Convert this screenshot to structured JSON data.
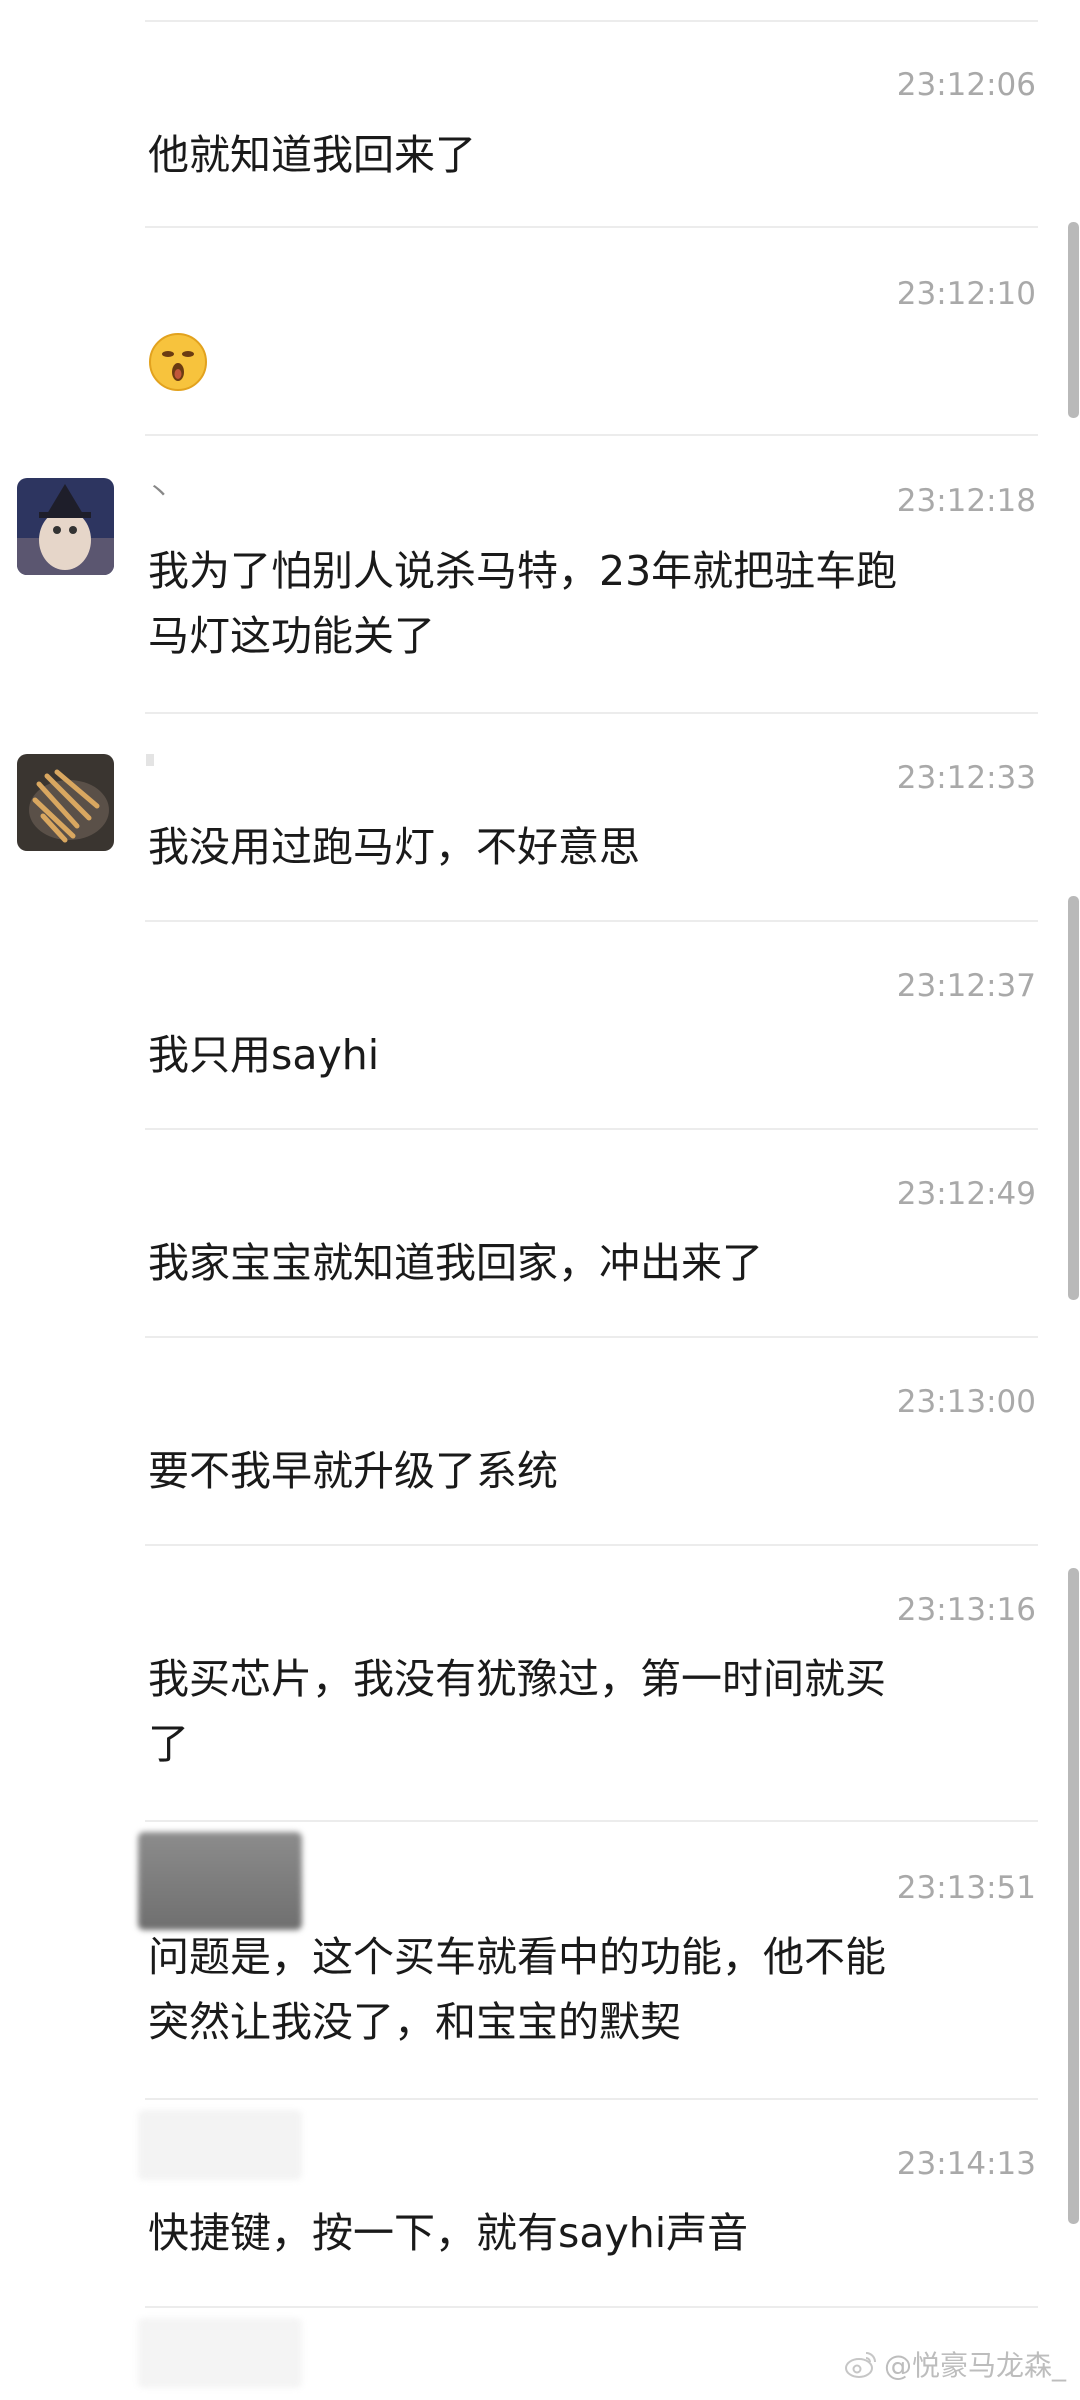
{
  "messages": [
    {
      "time": "23:12:06",
      "text": "他就知道我回来了"
    },
    {
      "time": "23:12:10",
      "emoji": "surprised-face-emoji"
    },
    {
      "time": "23:12:18",
      "sender_fragment": "丶",
      "text": "我为了怕别人说杀马特，23年就把驻车跑\n马灯这功能关了"
    },
    {
      "time": "23:12:33",
      "text": "我没用过跑马灯，不好意思"
    },
    {
      "time": "23:12:37",
      "text": "我只用sayhi"
    },
    {
      "time": "23:12:49",
      "text": "我家宝宝就知道我回家，冲出来了"
    },
    {
      "time": "23:13:00",
      "text": "要不我早就升级了系统"
    },
    {
      "time": "23:13:16",
      "text": "我买芯片，我没有犹豫过，第一时间就买\n了"
    },
    {
      "time": "23:13:51",
      "text": "问题是，这个买车就看中的功能，他不能\n突然让我没了，和宝宝的默契"
    },
    {
      "time": "23:14:13",
      "text": "快捷键，按一下，就有sayhi声音"
    }
  ],
  "watermark": {
    "icon": "weibo-icon",
    "text": "@悦豪马龙森_"
  }
}
